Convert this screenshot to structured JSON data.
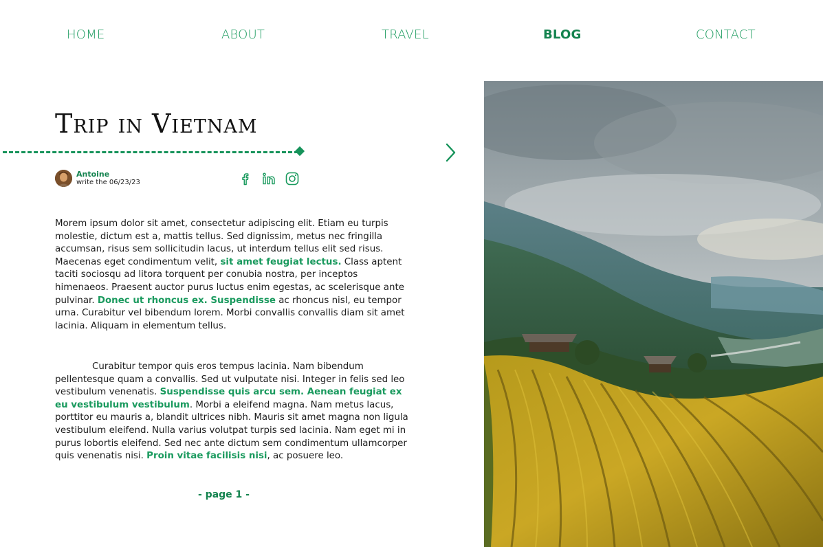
{
  "nav": {
    "items": [
      {
        "label": "HOME",
        "active": false
      },
      {
        "label": "ABOUT",
        "active": false
      },
      {
        "label": "TRAVEL",
        "active": false
      },
      {
        "label": "BLOG",
        "active": true
      },
      {
        "label": "CONTACT",
        "active": false
      }
    ]
  },
  "article": {
    "title": "Trip in Vietnam",
    "author": {
      "name": "Antoine",
      "date_text": "write the 06/23/23"
    },
    "socials": [
      "facebook-icon",
      "linkedin-icon",
      "instagram-icon"
    ],
    "paragraph1": [
      {
        "text": "Morem ipsum dolor sit amet, consectetur adipiscing elit. Etiam eu turpis molestie, dictum est a, mattis tellus. Sed dignissim, metus nec fringilla accumsan, risus sem sollicitudin lacus, ut interdum tellus elit sed risus. Maecenas eget condimentum velit, ",
        "highlight": false
      },
      {
        "text": "sit amet feugiat lectus.",
        "highlight": true
      },
      {
        "text": " Class aptent taciti sociosqu ad litora torquent per conubia nostra, per inceptos himenaeos. Praesent auctor purus luctus enim egestas, ac scelerisque ante pulvinar. ",
        "highlight": false
      },
      {
        "text": "Donec ut rhoncus ex. Suspendisse",
        "highlight": true
      },
      {
        "text": " ac rhoncus nisl, eu tempor urna. Curabitur vel bibendum lorem. Morbi convallis convallis diam sit amet lacinia. Aliquam in elementum tellus.",
        "highlight": false
      }
    ],
    "paragraph2": [
      {
        "text": "Curabitur tempor quis eros tempus lacinia. Nam bibendum pellentesque quam a convallis. Sed ut vulputate nisi. Integer in felis sed leo vestibulum venenatis. ",
        "highlight": false
      },
      {
        "text": "Suspendisse quis arcu sem. Aenean feugiat ex eu vestibulum vestibulum",
        "highlight": true
      },
      {
        "text": ". Morbi a eleifend magna. Nam metus lacus, porttitor eu mauris a, blandit ultrices nibh. Mauris sit amet magna non ligula vestibulum eleifend. Nulla varius volutpat turpis sed lacinia. Nam eget mi in purus lobortis eleifend. Sed nec ante dictum sem condimentum ullamcorper quis venenatis nisi. ",
        "highlight": false
      },
      {
        "text": "Proin vitae facilisis nisi",
        "highlight": true
      },
      {
        "text": ", ac posuere leo.",
        "highlight": false
      }
    ],
    "pager_label": "-   page 1   -"
  },
  "colors": {
    "accent": "#1a9a5e",
    "accent_dark": "#14834f",
    "text": "#1c1c1c"
  },
  "photo": {
    "subject": "rice-terraces-landscape"
  }
}
